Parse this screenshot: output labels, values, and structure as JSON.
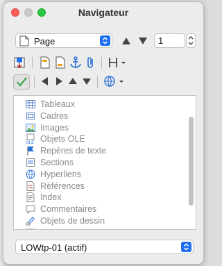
{
  "window": {
    "title": "Navigateur"
  },
  "navigation": {
    "type_select": {
      "value": "Page",
      "icon": "page-icon"
    },
    "page_number": "1"
  },
  "colors": {
    "accent": "#1e6ff2",
    "check_green": "#3aa64a",
    "anchor_blue": "#2a6fd6"
  },
  "list": {
    "items": [
      {
        "label": "Tableaux",
        "icon": "table-icon"
      },
      {
        "label": "Cadres",
        "icon": "frame-icon"
      },
      {
        "label": "Images",
        "icon": "image-icon"
      },
      {
        "label": "Objets OLE",
        "icon": "ole-icon"
      },
      {
        "label": "Repères de texte",
        "icon": "bookmark-flag-icon"
      },
      {
        "label": "Sections",
        "icon": "section-icon"
      },
      {
        "label": "Hyperliens",
        "icon": "globe-icon"
      },
      {
        "label": "Références",
        "icon": "reference-icon"
      },
      {
        "label": "Index",
        "icon": "index-icon"
      },
      {
        "label": "Commentaires",
        "icon": "comment-icon"
      },
      {
        "label": "Objets de dessin",
        "icon": "drawing-icon"
      },
      {
        "label": "Ch...",
        "icon": "field-icon"
      }
    ]
  },
  "document_select": {
    "value": "LOWtp-01 (actif)"
  }
}
